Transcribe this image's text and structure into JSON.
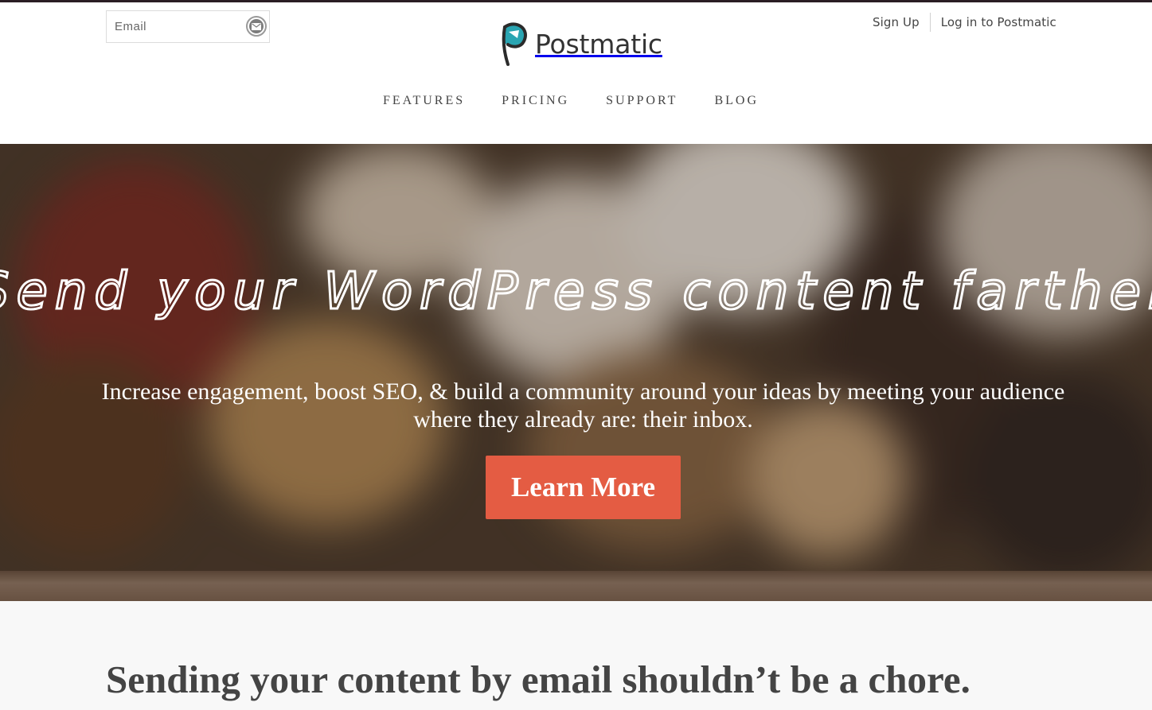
{
  "header": {
    "email": {
      "placeholder": "Email"
    },
    "logo": {
      "text": "Postmatic",
      "icon": "postmatic-p-logo-icon",
      "accent": "#2aa5b2"
    },
    "account": {
      "signup": "Sign Up",
      "login": "Log in to Postmatic"
    }
  },
  "nav": {
    "items": [
      {
        "label": "FEATURES"
      },
      {
        "label": "PRICING"
      },
      {
        "label": "SUPPORT"
      },
      {
        "label": "BLOG"
      }
    ]
  },
  "hero": {
    "headline": "Send your WordPress content farther",
    "subtext": "Increase engagement, boost SEO, & build a community around your ideas by meeting your audience where they already are: their inbox.",
    "cta": "Learn More",
    "cta_color": "#e45c43"
  },
  "section": {
    "heading": "Sending your content by email shouldn’t be a chore."
  },
  "icons": {
    "email_submit": "envelope-icon"
  }
}
